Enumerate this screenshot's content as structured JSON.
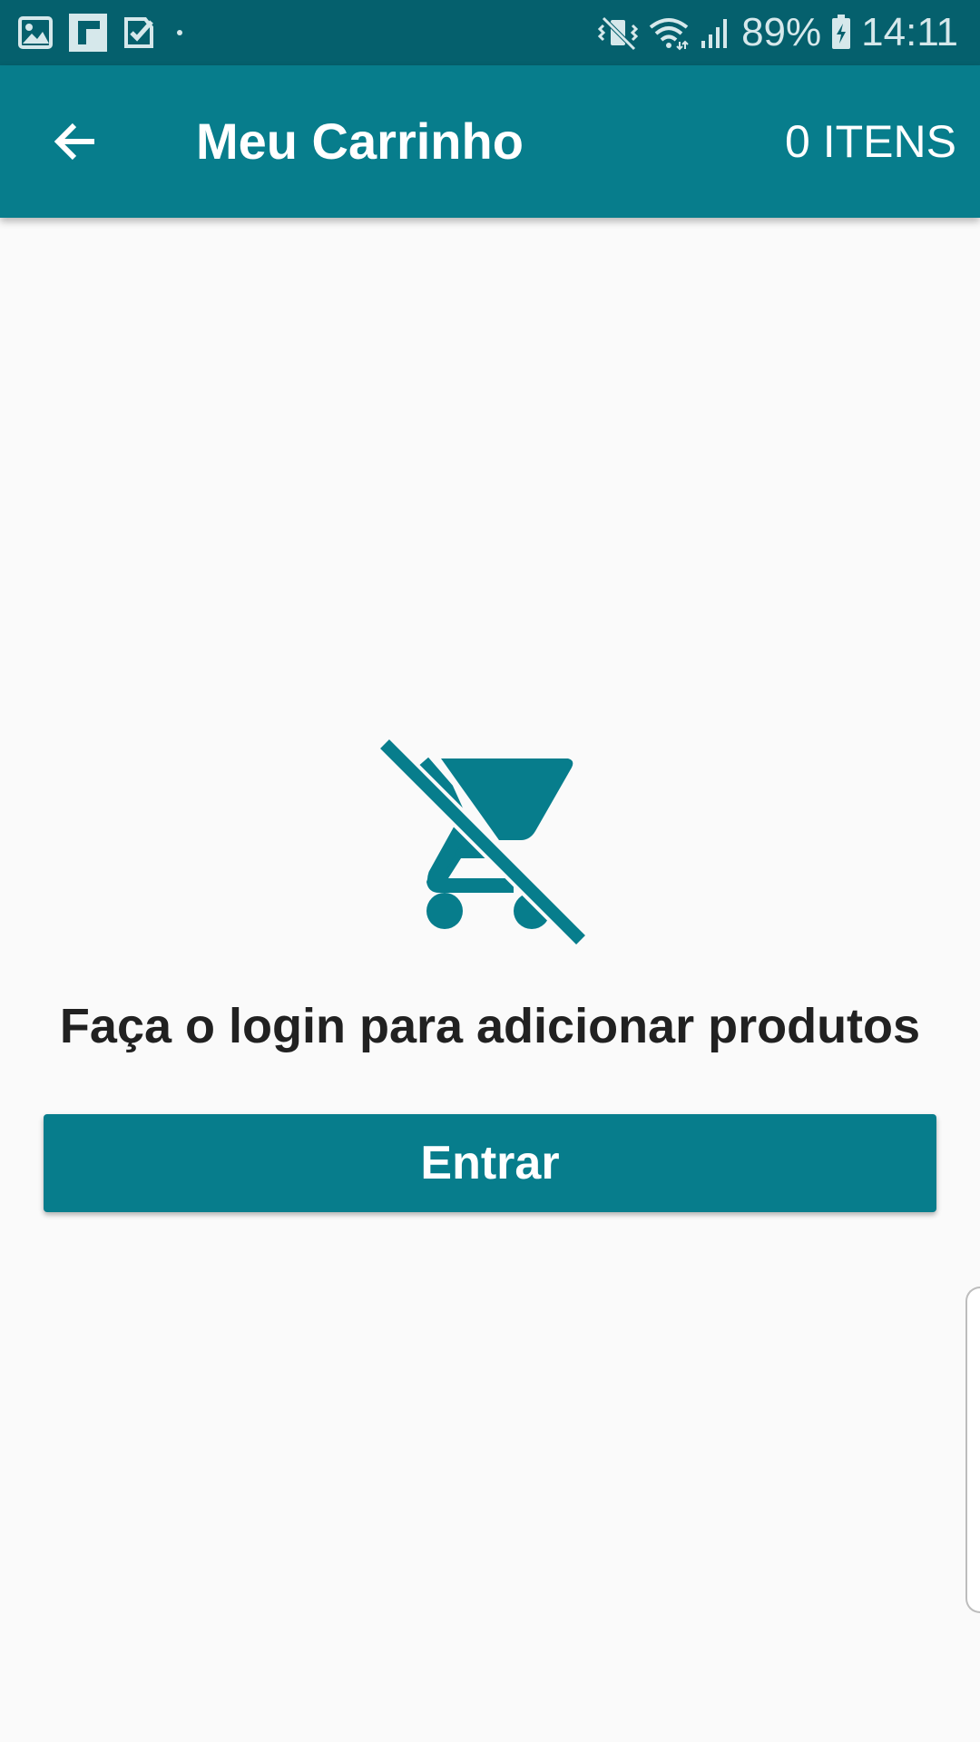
{
  "status_bar": {
    "left_icons": [
      "gallery-icon",
      "flipboard-icon",
      "tasks-check-icon",
      "notification-dot-icon"
    ],
    "right_icons": [
      "vibrate-mute-icon",
      "wifi-icon",
      "signal-icon",
      "battery-charging-icon"
    ],
    "battery": "89%",
    "time": "14:11"
  },
  "app_bar": {
    "back_icon": "arrow-back-icon",
    "title": "Meu Carrinho",
    "item_count": "0 ITENS"
  },
  "main": {
    "empty_icon": "remove-shopping-cart-icon",
    "message": "Faça o login para adicionar produtos",
    "login_button_label": "Entrar"
  },
  "colors": {
    "status_bar": "#05606D",
    "primary": "#077D8C",
    "background": "#FAFAFA",
    "text_dark": "#212121"
  }
}
